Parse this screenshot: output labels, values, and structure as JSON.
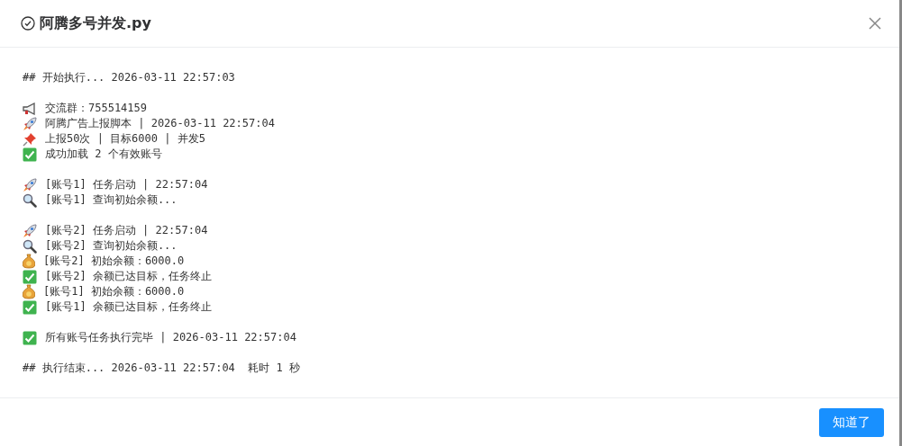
{
  "dialog": {
    "title": "阿腾多号并发.py",
    "ok_button": "知道了"
  },
  "log": [
    [
      {
        "kind": "heading",
        "text": "## 开始执行... 2026-03-11 22:57:03"
      }
    ],
    [
      {
        "kind": "megaphone",
        "text": "交流群：755514159"
      },
      {
        "kind": "rocket",
        "text": "阿腾广告上报脚本 | 2026-03-11 22:57:04"
      },
      {
        "kind": "pin",
        "text": "上报50次 | 目标6000 | 并发5"
      },
      {
        "kind": "check",
        "text": "成功加载 2 个有效账号"
      }
    ],
    [
      {
        "kind": "rocket",
        "text": "[账号1] 任务启动 | 22:57:04"
      },
      {
        "kind": "search",
        "text": "[账号1] 查询初始余额..."
      }
    ],
    [
      {
        "kind": "rocket",
        "text": "[账号2] 任务启动 | 22:57:04"
      },
      {
        "kind": "search",
        "text": "[账号2] 查询初始余额..."
      },
      {
        "kind": "money",
        "text": "[账号2] 初始余额：6000.0"
      },
      {
        "kind": "check",
        "text": "[账号2] 余额已达目标，任务终止"
      },
      {
        "kind": "money",
        "text": "[账号1] 初始余额：6000.0"
      },
      {
        "kind": "check",
        "text": "[账号1] 余额已达目标，任务终止"
      }
    ],
    [
      {
        "kind": "check",
        "text": "所有账号任务执行完毕 | 2026-03-11 22:57:04"
      }
    ],
    [
      {
        "kind": "heading",
        "text": "## 执行结束... 2026-03-11 22:57:04  耗时 1 秒"
      }
    ]
  ]
}
